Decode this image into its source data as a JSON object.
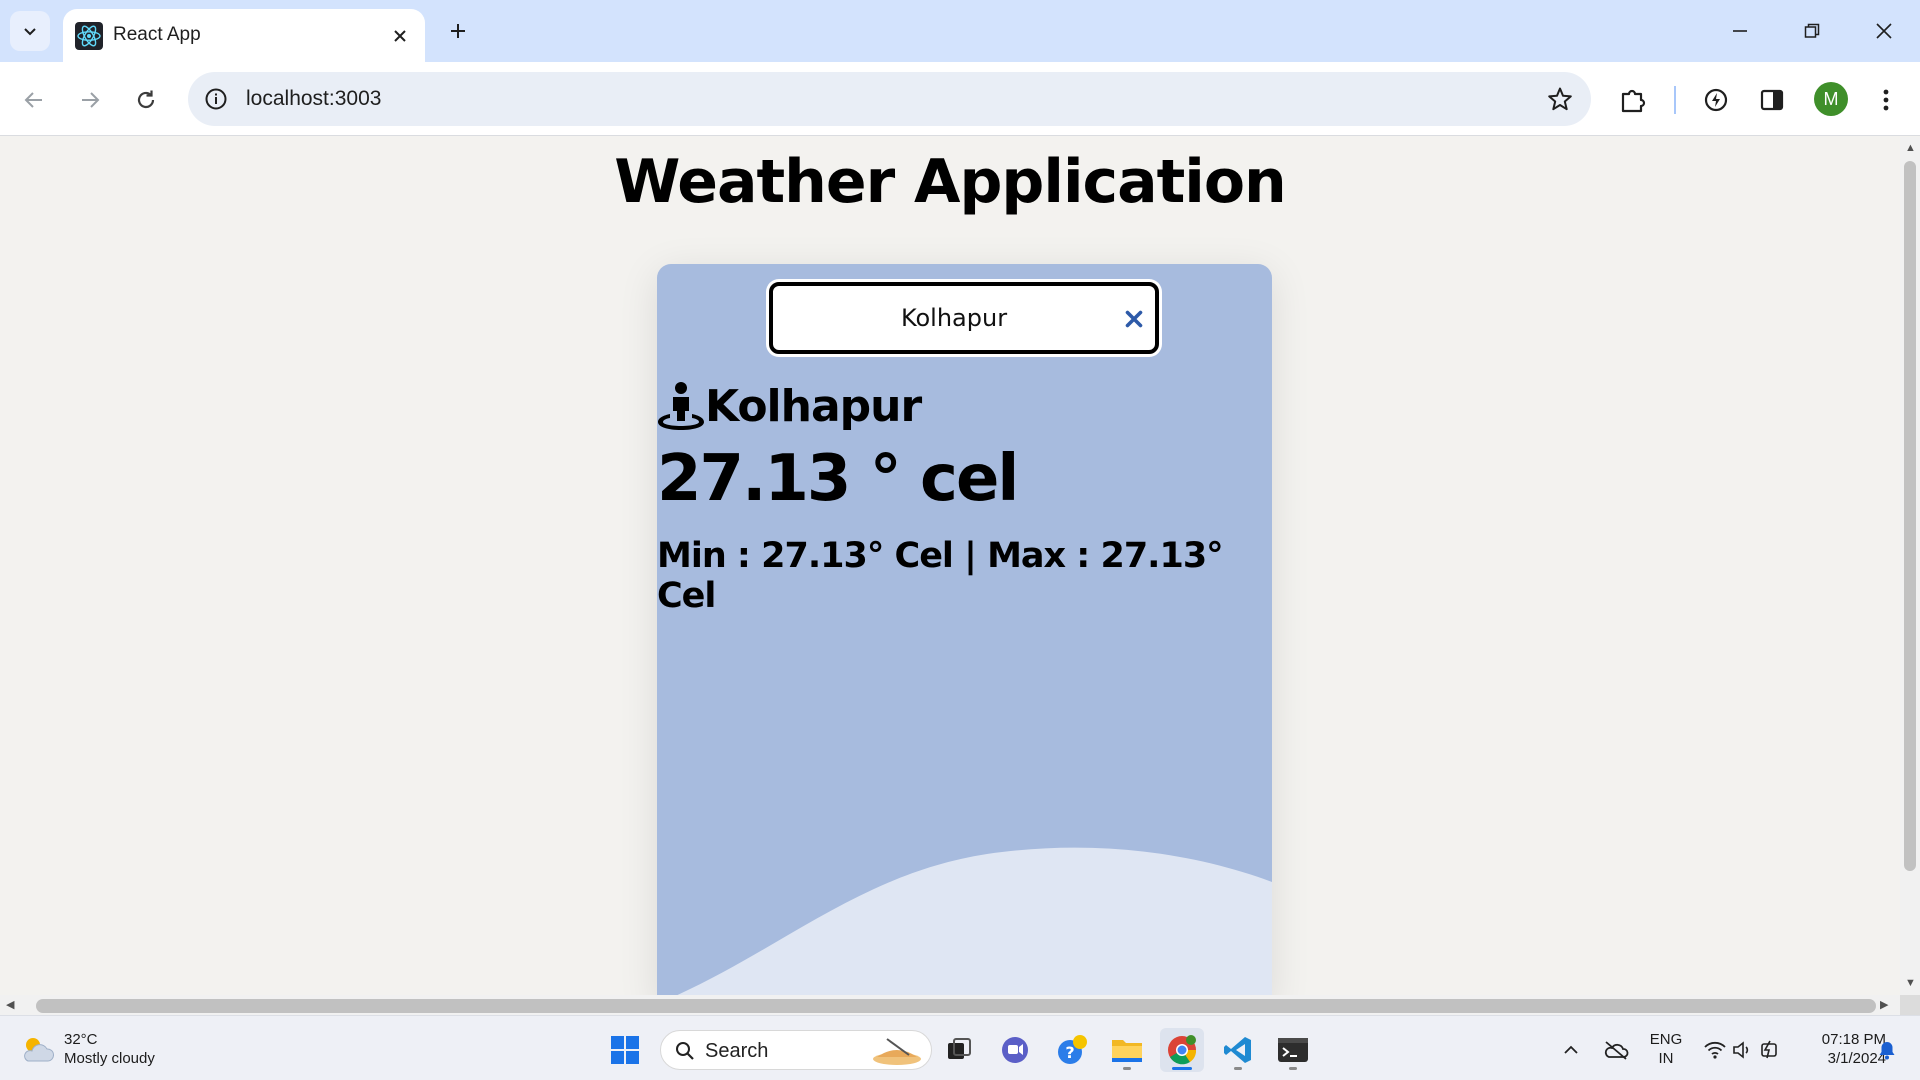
{
  "browser": {
    "tab_title": "React App",
    "url": "localhost:3003",
    "profile_initial": "M"
  },
  "page": {
    "title": "Weather Application",
    "search_value": "Kolhapur",
    "city": "Kolhapur",
    "temperature": "27.13 ° cel",
    "min_max": "Min : 27.13° Cel | Max : 27.13° Cel"
  },
  "colors": {
    "card_bg": "#a7bbde",
    "wave": "#dfe6f3",
    "page_bg": "#f3f2ef"
  },
  "taskbar": {
    "weather_temp": "32°C",
    "weather_desc": "Mostly cloudy",
    "search_label": "Search",
    "lang_top": "ENG",
    "lang_bottom": "IN",
    "time": "07:18 PM",
    "date": "3/1/2024"
  }
}
